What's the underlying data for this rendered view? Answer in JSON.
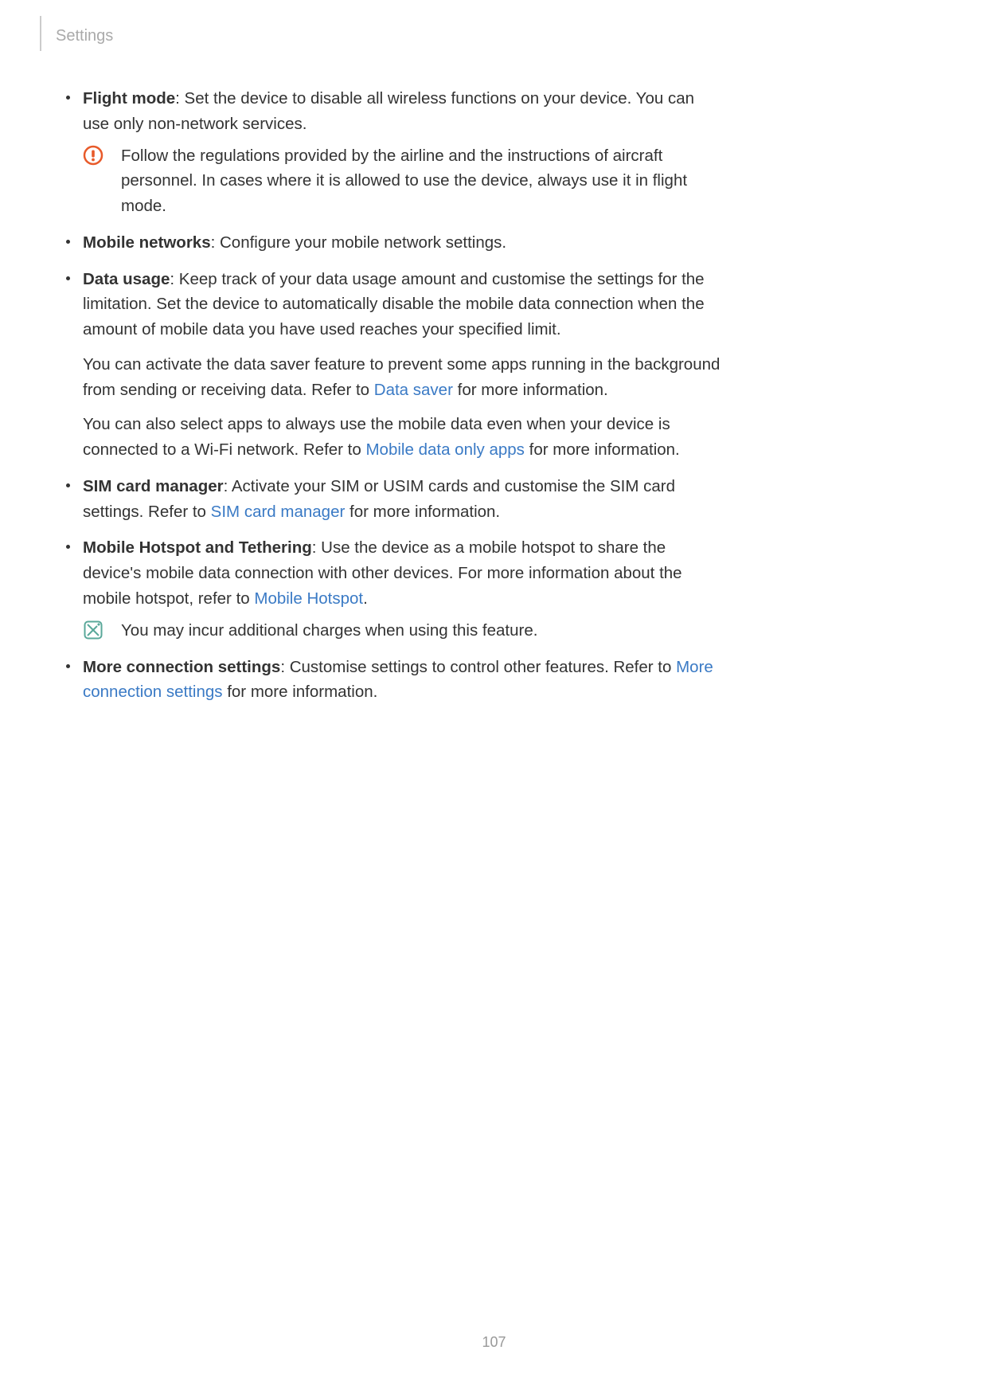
{
  "header": {
    "title": "Settings"
  },
  "page_number": "107",
  "items": {
    "flight_mode": {
      "title": "Flight mode",
      "desc": ": Set the device to disable all wireless functions on your device. You can use only non-network services.",
      "note": "Follow the regulations provided by the airline and the instructions of aircraft personnel. In cases where it is allowed to use the device, always use it in flight mode."
    },
    "mobile_networks": {
      "title": "Mobile networks",
      "desc": ": Configure your mobile network settings."
    },
    "data_usage": {
      "title": "Data usage",
      "desc": ": Keep track of your data usage amount and customise the settings for the limitation. Set the device to automatically disable the mobile data connection when the amount of mobile data you have used reaches your specified limit.",
      "para2_a": "You can activate the data saver feature to prevent some apps running in the background from sending or receiving data. Refer to ",
      "para2_link": "Data saver",
      "para2_b": " for more information.",
      "para3_a": "You can also select apps to always use the mobile data even when your device is connected to a Wi-Fi network. Refer to ",
      "para3_link": "Mobile data only apps",
      "para3_b": " for more information."
    },
    "sim_card_manager": {
      "title": "SIM card manager",
      "desc_a": ": Activate your SIM or USIM cards and customise the SIM card settings. Refer to ",
      "link": "SIM card manager",
      "desc_b": " for more information."
    },
    "hotspot": {
      "title": "Mobile Hotspot and Tethering",
      "desc_a": ": Use the device as a mobile hotspot to share the device's mobile data connection with other devices. For more information about the mobile hotspot, refer to ",
      "link": "Mobile Hotspot",
      "desc_b": ".",
      "note": "You may incur additional charges when using this feature."
    },
    "more_connection": {
      "title": "More connection settings",
      "desc_a": ": Customise settings to control other features. Refer to ",
      "link": "More connection settings",
      "desc_b": " for more information."
    }
  }
}
